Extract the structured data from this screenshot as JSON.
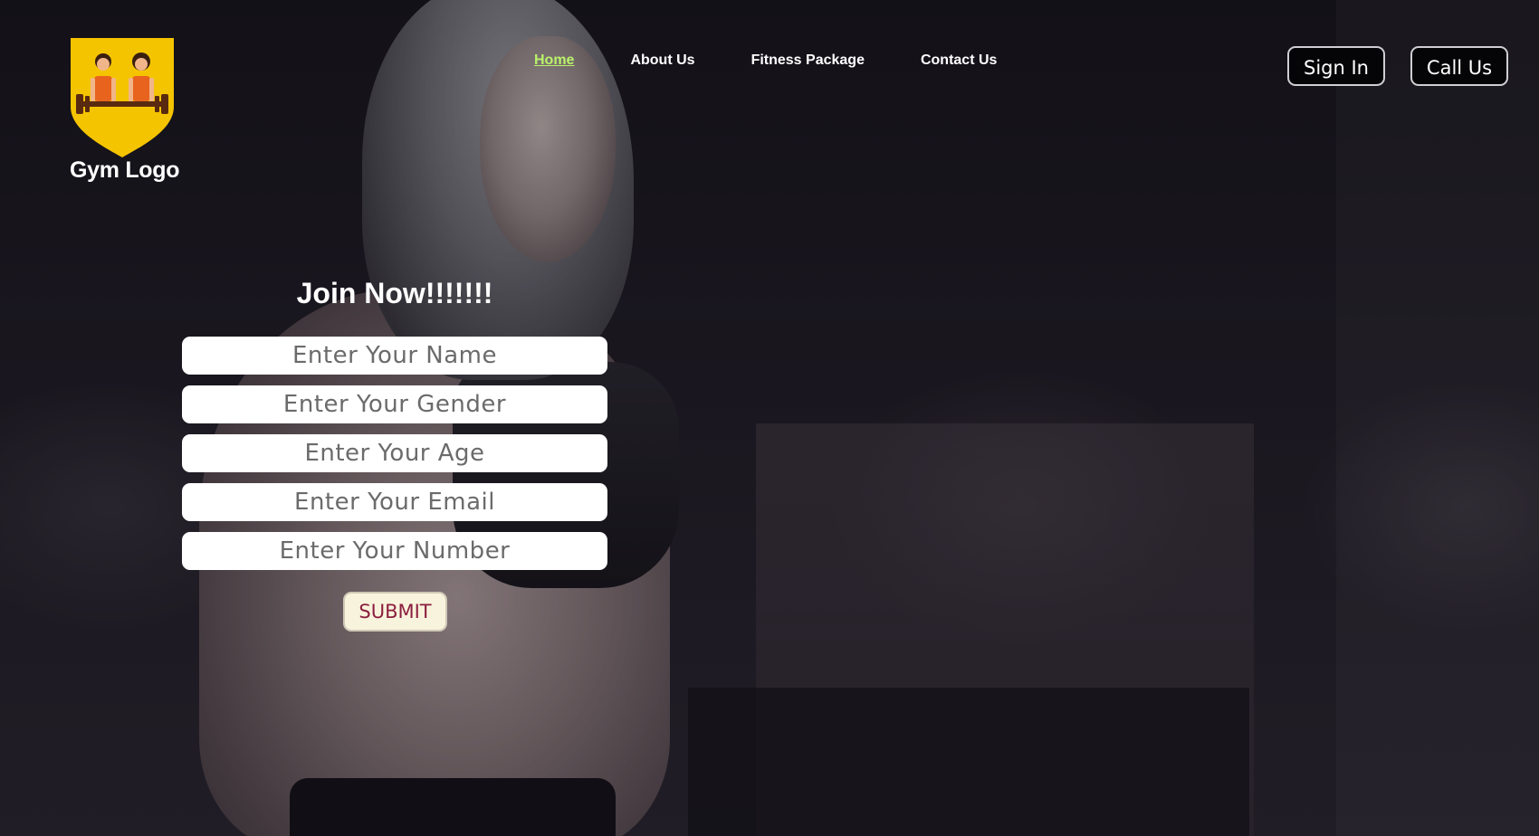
{
  "logo": {
    "text": "Gym Logo",
    "colors": {
      "shield": "#f5c400",
      "figures": "#e8641e",
      "bar": "#5a2a10"
    }
  },
  "nav": {
    "items": [
      {
        "label": "Home",
        "active": true
      },
      {
        "label": "About Us",
        "active": false
      },
      {
        "label": "Fitness Package",
        "active": false
      },
      {
        "label": "Contact Us",
        "active": false
      }
    ],
    "active_color": "#b8f26a"
  },
  "actions": {
    "sign_in": "Sign In",
    "call_us": "Call Us"
  },
  "form": {
    "title": "Join Now!!!!!!!",
    "fields": {
      "name": {
        "placeholder": "Enter Your Name"
      },
      "gender": {
        "placeholder": "Enter Your Gender"
      },
      "age": {
        "placeholder": "Enter Your Age"
      },
      "email": {
        "placeholder": "Enter Your Email"
      },
      "number": {
        "placeholder": "Enter Your Number"
      }
    },
    "submit_label": "SUBMIT",
    "submit_color": "#8b1e3f"
  }
}
